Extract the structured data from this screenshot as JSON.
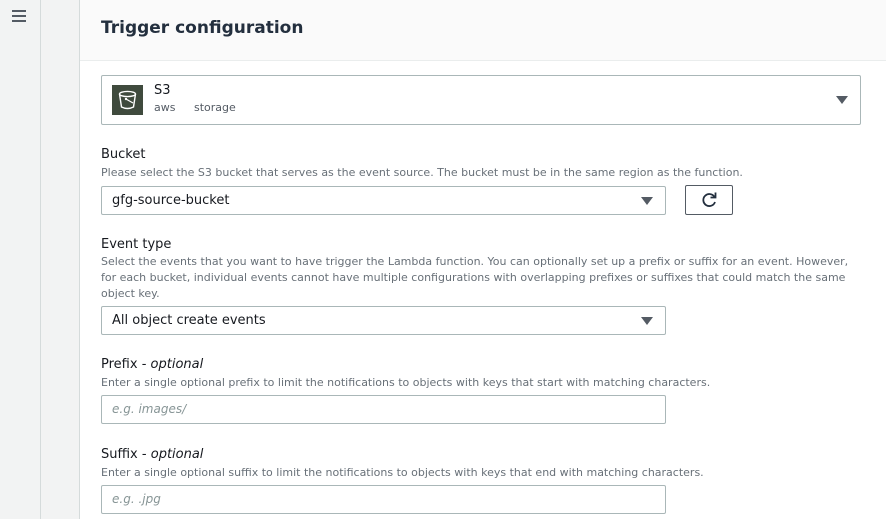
{
  "panel": {
    "title": "Trigger configuration"
  },
  "service": {
    "name": "S3",
    "tag1": "aws",
    "tag2": "storage",
    "icon": "s3-bucket-icon"
  },
  "bucket": {
    "label": "Bucket",
    "description": "Please select the S3 bucket that serves as the event source. The bucket must be in the same region as the function.",
    "value": "gfg-source-bucket",
    "refresh_icon": "refresh-icon"
  },
  "event_type": {
    "label": "Event type",
    "description": "Select the events that you want to have trigger the Lambda function. You can optionally set up a prefix or suffix for an event. However, for each bucket, individual events cannot have multiple configurations with overlapping prefixes or suffixes that could match the same object key.",
    "value": "All object create events"
  },
  "prefix": {
    "label": "Prefix",
    "optional": "optional",
    "description": "Enter a single optional prefix to limit the notifications to objects with keys that start with matching characters.",
    "placeholder": "e.g. images/"
  },
  "suffix": {
    "label": "Suffix",
    "optional": "optional",
    "description": "Enter a single optional suffix to limit the notifications to objects with keys that end with matching characters.",
    "placeholder": "e.g. .jpg"
  },
  "colors": {
    "accent": "#232f3e",
    "border": "#aab7b8",
    "muted": "#687078"
  }
}
